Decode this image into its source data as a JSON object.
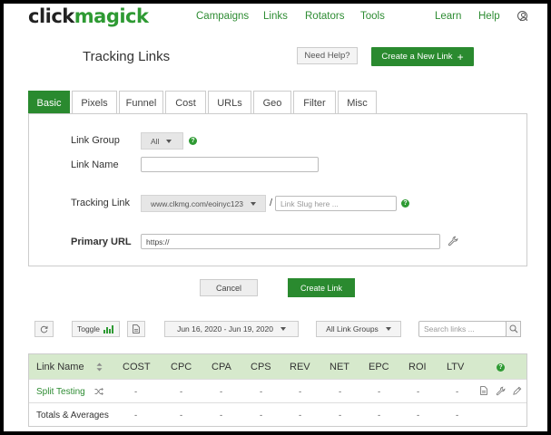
{
  "logo": {
    "click": "click",
    "magick": "magick"
  },
  "nav": {
    "campaigns": "Campaigns",
    "links": "Links",
    "rotators": "Rotators",
    "tools": "Tools",
    "learn": "Learn",
    "help": "Help"
  },
  "header": {
    "title": "Tracking Links",
    "need_help": "Need Help?",
    "create_new": "Create a New Link",
    "create_new_icon": "+"
  },
  "tabs": [
    {
      "label": "Basic",
      "active": true
    },
    {
      "label": "Pixels"
    },
    {
      "label": "Funnel"
    },
    {
      "label": "Cost"
    },
    {
      "label": "URLs"
    },
    {
      "label": "Geo"
    },
    {
      "label": "Filter"
    },
    {
      "label": "Misc"
    }
  ],
  "form": {
    "link_group_label": "Link Group",
    "link_group_value": "All",
    "link_name_label": "Link Name",
    "link_name_value": "",
    "tracking_link_label": "Tracking Link",
    "tracking_domain": "www.clkmg.com/eoinyc123",
    "slash": "/",
    "slug_placeholder": "Link Slug here ...",
    "primary_url_label": "Primary URL",
    "primary_url_value": "https://",
    "help_glyph": "?"
  },
  "actions": {
    "cancel": "Cancel",
    "create": "Create Link"
  },
  "toolbar": {
    "toggle": "Toggle",
    "date_range": "Jun 16, 2020 - Jun 19, 2020",
    "link_groups": "All Link Groups",
    "search_placeholder": "Search links ..."
  },
  "table": {
    "columns": [
      "Link Name",
      "COST",
      "CPC",
      "CPA",
      "CPS",
      "REV",
      "NET",
      "EPC",
      "ROI",
      "LTV"
    ],
    "rows": [
      {
        "name": "Split Testing",
        "values": [
          "-",
          "-",
          "-",
          "-",
          "-",
          "-",
          "-",
          "-",
          "-"
        ]
      },
      {
        "name": "Totals & Averages",
        "values": [
          "-",
          "-",
          "-",
          "-",
          "-",
          "-",
          "-",
          "-",
          "-"
        ]
      }
    ]
  },
  "colors": {
    "brand_green": "#2a8a2f",
    "header_green": "#d6e9cc"
  }
}
